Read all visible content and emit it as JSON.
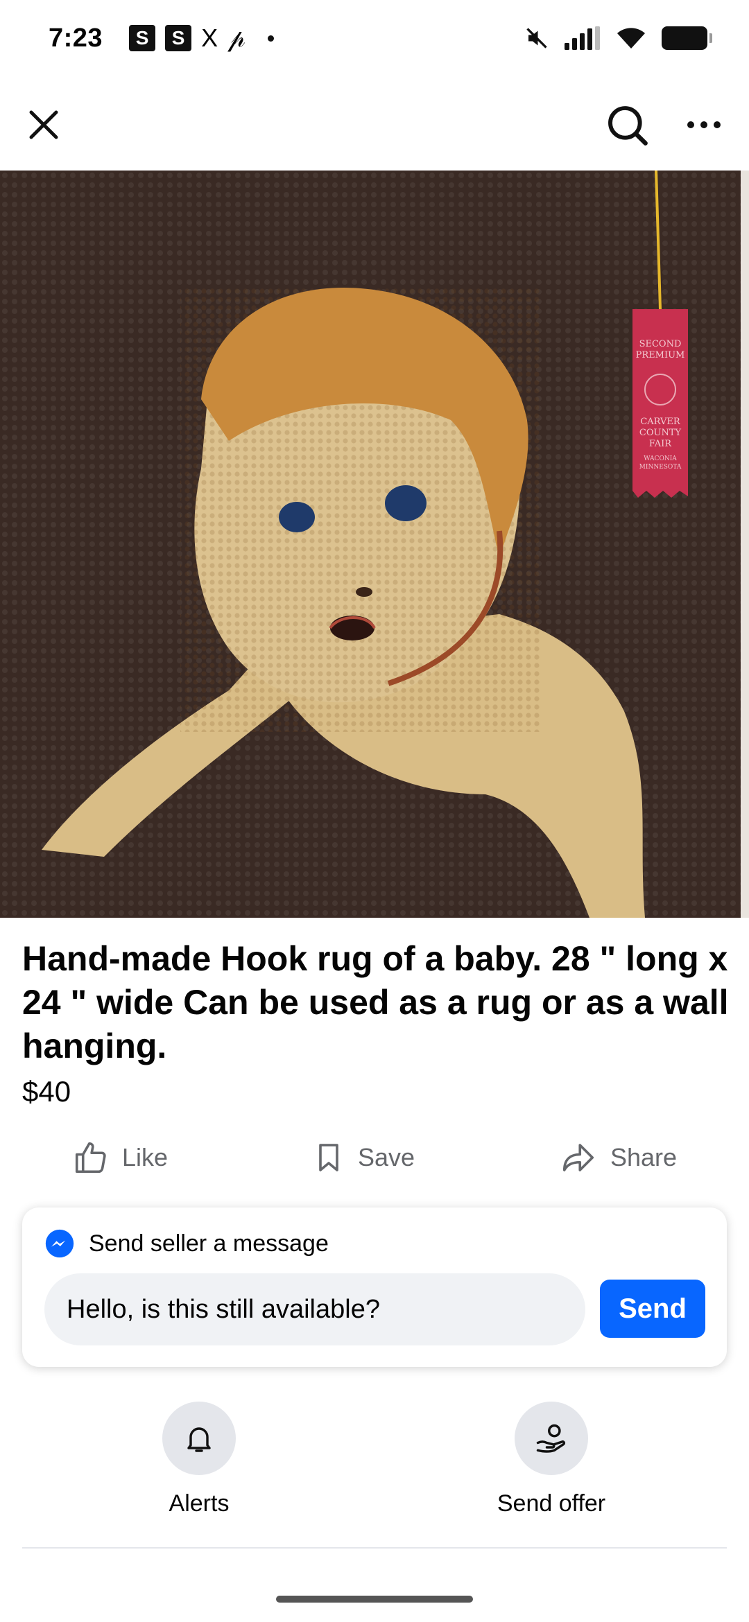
{
  "status_bar": {
    "time": "7:23",
    "notif_icons": [
      "S",
      "S",
      "X",
      "𝓅"
    ]
  },
  "header": {
    "close_icon": "close-icon",
    "search_icon": "search-icon",
    "more_icon": "more-icon"
  },
  "listing": {
    "title": "Hand-made Hook rug of a baby.  28 \" long x 24 \" wide  Can be used as a rug or as a wall hanging.",
    "price": "$40",
    "ribbon_text": [
      "SECOND",
      "PREMIUM",
      "CARVER",
      "COUNTY",
      "FAIR",
      "WACONIA",
      "MINNESOTA"
    ]
  },
  "actions": {
    "like": "Like",
    "save": "Save",
    "share": "Share"
  },
  "message": {
    "heading": "Send seller a message",
    "input_value": "Hello, is this still available?",
    "send_label": "Send"
  },
  "options": {
    "alerts": "Alerts",
    "send_offer": "Send offer"
  },
  "colors": {
    "accent": "#0866ff",
    "muted": "#65676b",
    "chip_bg": "#e4e6eb",
    "rug_background": "#3a2a24",
    "ribbon": "#c8304f"
  }
}
